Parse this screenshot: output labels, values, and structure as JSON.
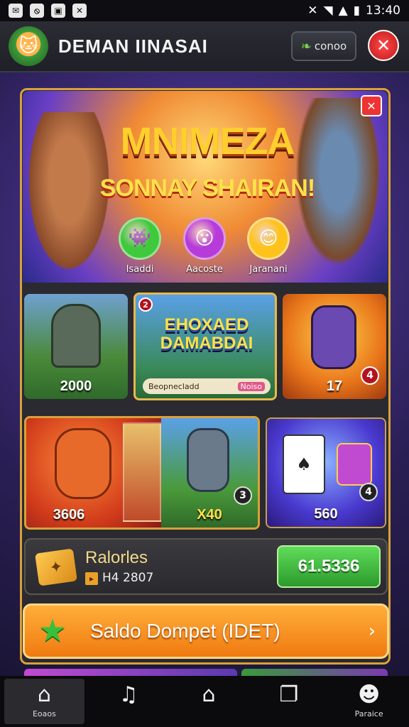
{
  "status_bar": {
    "time": "13:40"
  },
  "header": {
    "title": "DEMAN IINASAI",
    "coin_button_label": "conoo"
  },
  "banner": {
    "title": "MNIMEZA",
    "subtitle": "SONNAY SHAIRAN!",
    "options": [
      {
        "label": "Isaddi",
        "color": "#3fc93c"
      },
      {
        "label": "Aacoste",
        "color": "#b63bd9"
      },
      {
        "label": "Jaranani",
        "color": "#ffc21a"
      }
    ]
  },
  "games_row1": [
    {
      "value": "2000"
    },
    {
      "title": "EHOXAED DAMABDAI",
      "bar_label": "Beopnecladd",
      "bar_tag": "Noiso",
      "badge": "2"
    },
    {
      "value": "17",
      "badge": "4"
    }
  ],
  "games_row2": [
    {
      "value": "3606"
    },
    {
      "value": "X40",
      "badge": "3"
    },
    {
      "value": "560",
      "badge": "4"
    }
  ],
  "balance": {
    "label": "Ralorles",
    "sub_value": "H4 2807",
    "button_value": "61.5336"
  },
  "wallet": {
    "label": "Saldo Dompet (IDET)"
  },
  "nav": {
    "items": [
      {
        "label": "Eoaos",
        "icon": "home-icon"
      },
      {
        "label": "",
        "icon": "music-icon"
      },
      {
        "label": "",
        "icon": "shop-icon"
      },
      {
        "label": "",
        "icon": "window-icon"
      },
      {
        "label": "Paraice",
        "icon": "profile-icon"
      }
    ]
  }
}
